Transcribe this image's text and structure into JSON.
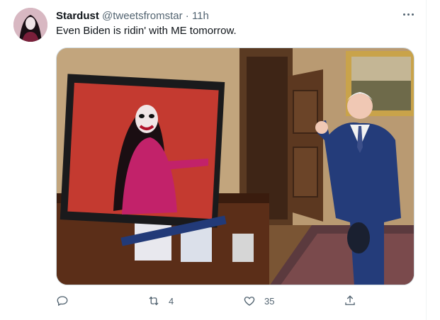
{
  "tweet": {
    "display_name": "Stardust",
    "handle": "@tweetsfromstar",
    "separator": "·",
    "time": "11h",
    "text": "Even Biden is ridin' with ME tomorrow.",
    "media_description_icon": "photo",
    "actions": {
      "reply_count": "",
      "retweet_count": "4",
      "like_count": "35",
      "share_count": ""
    }
  },
  "colors": {
    "name": "#0f1419",
    "secondary": "#536471",
    "border": "#cfd9de"
  },
  "icons": [
    "more-icon",
    "reply-icon",
    "retweet-icon",
    "like-icon",
    "share-icon"
  ]
}
